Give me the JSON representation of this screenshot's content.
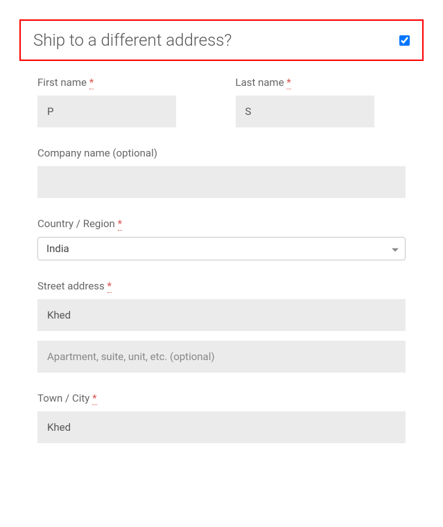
{
  "header": {
    "title": "Ship to a different address?",
    "checked": true
  },
  "fields": {
    "first_name": {
      "label": "First name",
      "required": "*",
      "value": "P"
    },
    "last_name": {
      "label": "Last name",
      "required": "*",
      "value": "S"
    },
    "company": {
      "label": "Company name (optional)",
      "value": ""
    },
    "country": {
      "label": "Country / Region",
      "required": "*",
      "value": "India"
    },
    "street": {
      "label": "Street address",
      "required": "*",
      "value": "Khed",
      "placeholder2": "Apartment, suite, unit, etc. (optional)"
    },
    "city": {
      "label": "Town / City",
      "required": "*",
      "value": "Khed"
    }
  }
}
